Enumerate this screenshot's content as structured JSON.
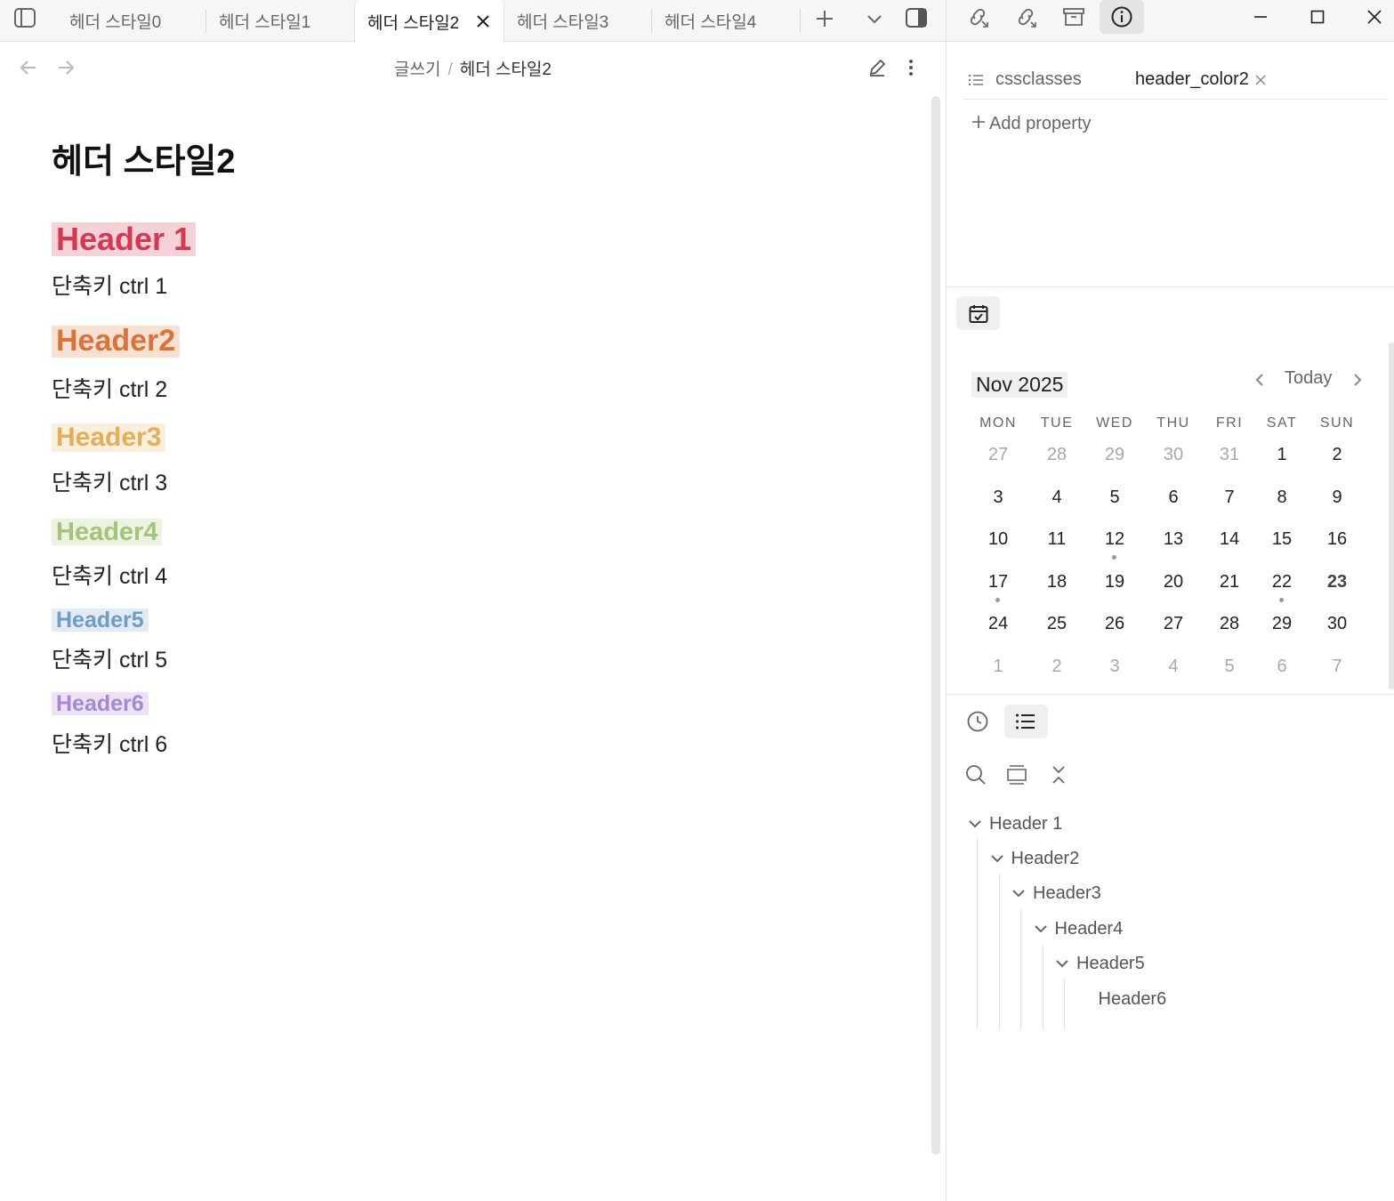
{
  "tabs": [
    {
      "label": "헤더 스타일0",
      "active": false
    },
    {
      "label": "헤더 스타일1",
      "active": false
    },
    {
      "label": "헤더 스타일2",
      "active": true
    },
    {
      "label": "헤더 스타일3",
      "active": false
    },
    {
      "label": "헤더 스타일4",
      "active": false
    }
  ],
  "breadcrumb": {
    "folder": "글쓰기",
    "separator": "/",
    "current": "헤더 스타일2"
  },
  "document": {
    "title": "헤더 스타일2",
    "sections": [
      {
        "header": "Header 1",
        "shortcut": "단축키 ctrl 1",
        "color": "#d13a52",
        "bg": "#f5d2d8"
      },
      {
        "header": "Header2",
        "shortcut": "단축키 ctrl 2",
        "color": "#d9733b",
        "bg": "#f8e0d2"
      },
      {
        "header": "Header3",
        "shortcut": "단축키 ctrl 3",
        "color": "#e3ad5a",
        "bg": "#faeedd"
      },
      {
        "header": "Header4",
        "shortcut": "단축키 ctrl 4",
        "color": "#a4c47a",
        "bg": "#ecf3e2"
      },
      {
        "header": "Header5",
        "shortcut": "단축키 ctrl 5",
        "color": "#6f9bc4",
        "bg": "#e1ebf4"
      },
      {
        "header": "Header6",
        "shortcut": "단축키 ctrl 6",
        "color": "#a787cf",
        "bg": "#ebe3f5"
      }
    ]
  },
  "properties": {
    "key": "cssclasses",
    "value": "header_color2",
    "add_label": "Add property"
  },
  "calendar": {
    "month": "Nov 2025",
    "today_label": "Today",
    "weekdays": [
      "MON",
      "TUE",
      "WED",
      "THU",
      "FRI",
      "SAT",
      "SUN"
    ],
    "weeks": [
      [
        "27",
        "28",
        "29",
        "30",
        "31",
        "1",
        "2"
      ],
      [
        "3",
        "4",
        "5",
        "6",
        "7",
        "8",
        "9"
      ],
      [
        "10",
        "11",
        "12",
        "13",
        "14",
        "15",
        "16"
      ],
      [
        "17",
        "18",
        "19",
        "20",
        "21",
        "22",
        "23"
      ],
      [
        "24",
        "25",
        "26",
        "27",
        "28",
        "29",
        "30"
      ],
      [
        "1",
        "2",
        "3",
        "4",
        "5",
        "6",
        "7"
      ]
    ],
    "today": "23",
    "dots": [
      "12",
      "17",
      "22"
    ]
  },
  "outline": [
    {
      "label": "Header 1",
      "level": 1,
      "collapsible": true
    },
    {
      "label": "Header2",
      "level": 2,
      "collapsible": true
    },
    {
      "label": "Header3",
      "level": 3,
      "collapsible": true
    },
    {
      "label": "Header4",
      "level": 4,
      "collapsible": true
    },
    {
      "label": "Header5",
      "level": 5,
      "collapsible": true
    },
    {
      "label": "Header6",
      "level": 6,
      "collapsible": false
    }
  ],
  "colors": {
    "accent_muted": "#666666",
    "divider": "#e3e3e3"
  }
}
